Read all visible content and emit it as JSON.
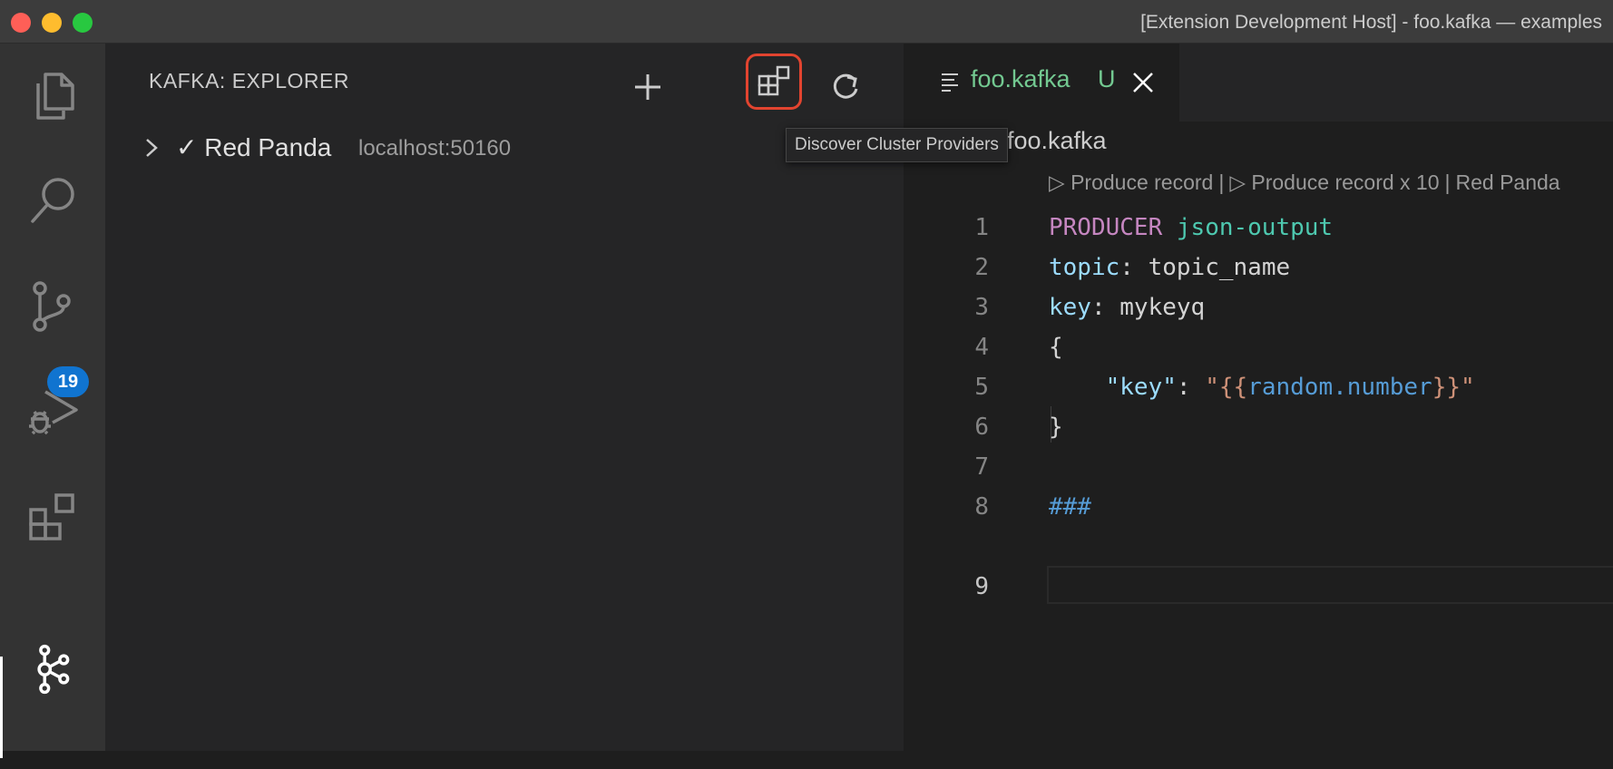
{
  "window": {
    "title": "[Extension Development Host] - foo.kafka — examples"
  },
  "activity_bar": {
    "items": [
      {
        "icon": "files-icon",
        "label": "Explorer"
      },
      {
        "icon": "search-icon",
        "label": "Search"
      },
      {
        "icon": "source-control-icon",
        "label": "Source Control",
        "badge": "19"
      },
      {
        "icon": "run-debug-icon",
        "label": "Run and Debug"
      },
      {
        "icon": "extensions-icon",
        "label": "Extensions"
      },
      {
        "icon": "kafka-icon",
        "label": "Kafka",
        "active": true
      }
    ]
  },
  "sidebar": {
    "title": "KAFKA: EXPLORER",
    "actions": [
      {
        "icon": "add-icon"
      },
      {
        "icon": "discover-cluster-providers-icon",
        "highlighted": true
      },
      {
        "icon": "refresh-icon"
      }
    ],
    "tree": [
      {
        "label": "✓ Red Panda",
        "description": "localhost:50160",
        "expanded": false
      }
    ]
  },
  "tooltip": {
    "text": "Discover Cluster Providers"
  },
  "editor": {
    "tab": {
      "filename": "foo.kafka",
      "status": "U"
    },
    "breadcrumb": "foo.kafka",
    "codelens": {
      "items": [
        "Produce record",
        "Produce record x 10",
        "Red Panda"
      ]
    },
    "line_numbers": [
      "1",
      "2",
      "3",
      "4",
      "5",
      "6",
      "7",
      "8",
      "9"
    ],
    "current_line": "9",
    "code": {
      "l1_keyword": "PRODUCER",
      "l1_name": "json-output",
      "l2_key": "topic",
      "l2_sep": ": ",
      "l2_value": "topic_name",
      "l3_key": "key",
      "l3_sep": ": ",
      "l3_value": "mykeyq",
      "l4": "{",
      "l5_key": "\"key\"",
      "l5_sep": ": ",
      "l5_quote_open": "\"",
      "l5_open_braces": "{{",
      "l5_template": "random.number",
      "l5_close_braces": "}}",
      "l5_quote_close": "\"",
      "l6": "}",
      "l8": "###"
    }
  },
  "colors": {
    "accent_highlight": "#e2442f",
    "badge": "#1074d0",
    "untracked_file": "#73c991"
  }
}
